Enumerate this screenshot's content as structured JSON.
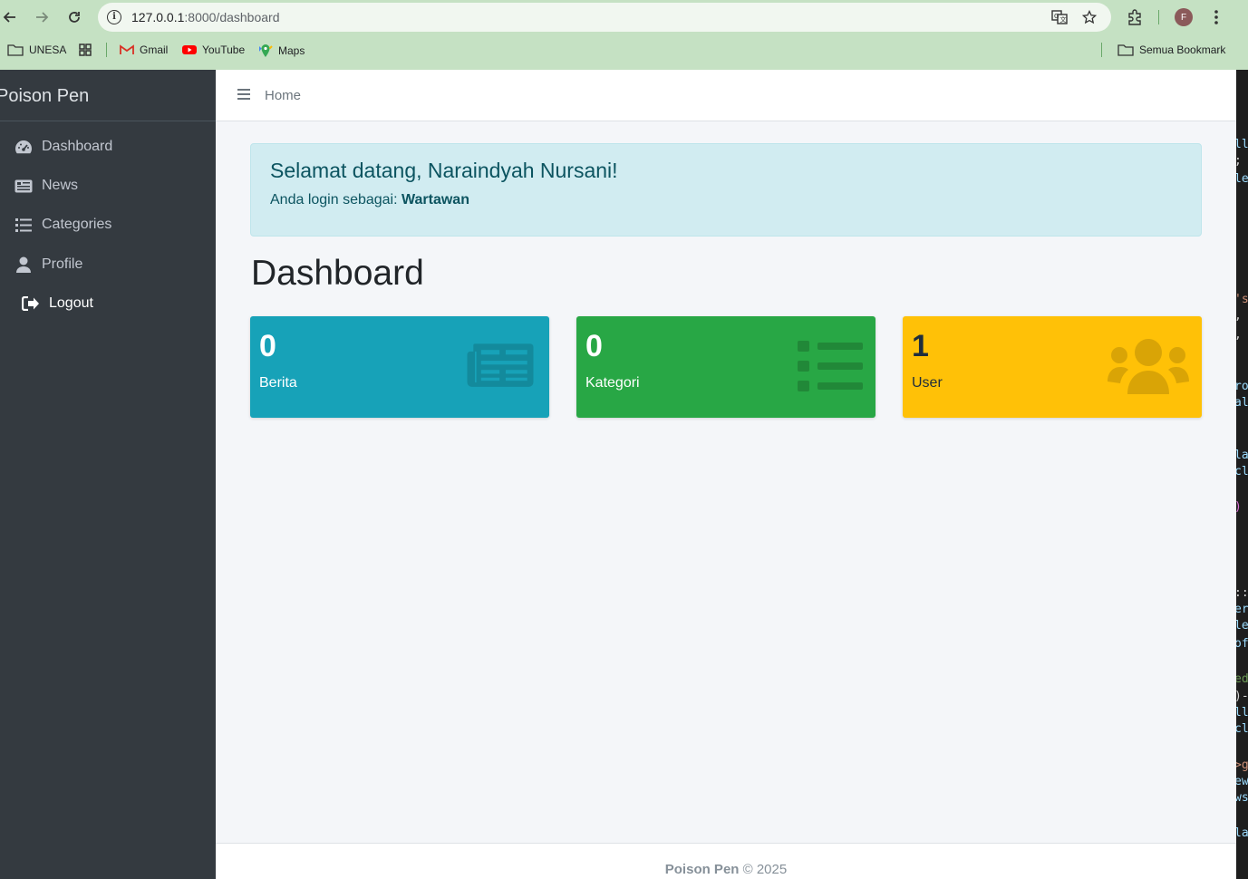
{
  "browser": {
    "url_host": "127.0.0.1",
    "url_path": ":8000/dashboard",
    "avatar_letter": "F",
    "bookmarks": [
      {
        "label": "UNESA",
        "icon": "folder-icon"
      },
      {
        "label": "",
        "icon": "apps-grid-icon"
      },
      {
        "label": "Gmail",
        "icon": "gmail-icon"
      },
      {
        "label": "YouTube",
        "icon": "youtube-icon"
      },
      {
        "label": "Maps",
        "icon": "maps-icon"
      }
    ],
    "all_bookmarks_label": "Semua Bookmark"
  },
  "sidebar": {
    "brand": "Poison Pen",
    "items": [
      {
        "label": "Dashboard",
        "icon": "tachometer-icon"
      },
      {
        "label": "News",
        "icon": "newspaper-icon"
      },
      {
        "label": "Categories",
        "icon": "list-icon"
      },
      {
        "label": "Profile",
        "icon": "user-icon"
      },
      {
        "label": "Logout",
        "icon": "sign-out-icon"
      }
    ]
  },
  "topnav": {
    "home_label": "Home"
  },
  "alert": {
    "title": "Selamat datang, Naraindyah Nursani!",
    "role_prefix": "Anda login sebagai: ",
    "role": "Wartawan"
  },
  "page_title": "Dashboard",
  "stats": [
    {
      "value": "0",
      "label": "Berita",
      "icon": "newspaper-icon",
      "color": "#17a2b8"
    },
    {
      "value": "0",
      "label": "Kategori",
      "icon": "list-icon",
      "color": "#28a745"
    },
    {
      "value": "1",
      "label": "User",
      "icon": "users-icon",
      "color": "#ffc107"
    }
  ],
  "footer": {
    "brand": "Poison Pen",
    "copyright": " © 2025"
  }
}
